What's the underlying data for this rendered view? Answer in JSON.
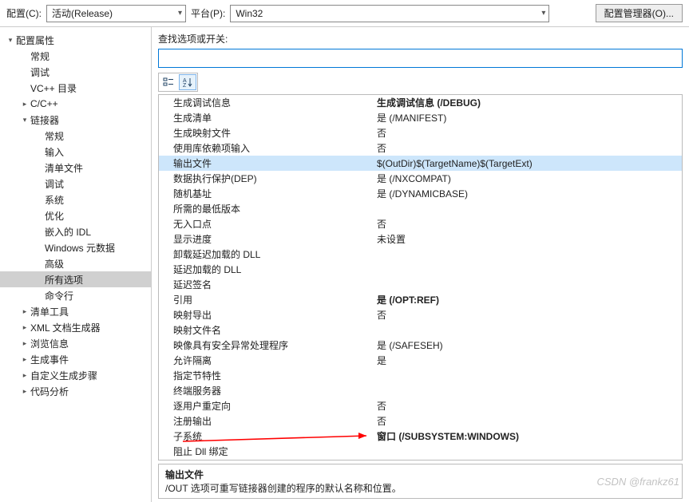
{
  "topbar": {
    "config_label": "配置(C):",
    "config_value": "活动(Release)",
    "platform_label": "平台(P):",
    "platform_value": "Win32",
    "config_manager_btn": "配置管理器(O)..."
  },
  "sidebar": {
    "items": [
      {
        "label": "配置属性",
        "depth": 0,
        "arrow": "▾"
      },
      {
        "label": "常规",
        "depth": 1,
        "arrow": ""
      },
      {
        "label": "调试",
        "depth": 1,
        "arrow": ""
      },
      {
        "label": "VC++ 目录",
        "depth": 1,
        "arrow": ""
      },
      {
        "label": "C/C++",
        "depth": 1,
        "arrow": "▸"
      },
      {
        "label": "链接器",
        "depth": 1,
        "arrow": "▾"
      },
      {
        "label": "常规",
        "depth": 2,
        "arrow": ""
      },
      {
        "label": "输入",
        "depth": 2,
        "arrow": ""
      },
      {
        "label": "清单文件",
        "depth": 2,
        "arrow": ""
      },
      {
        "label": "调试",
        "depth": 2,
        "arrow": ""
      },
      {
        "label": "系统",
        "depth": 2,
        "arrow": ""
      },
      {
        "label": "优化",
        "depth": 2,
        "arrow": ""
      },
      {
        "label": "嵌入的 IDL",
        "depth": 2,
        "arrow": ""
      },
      {
        "label": "Windows 元数据",
        "depth": 2,
        "arrow": ""
      },
      {
        "label": "高级",
        "depth": 2,
        "arrow": ""
      },
      {
        "label": "所有选项",
        "depth": 2,
        "arrow": "",
        "selected": true
      },
      {
        "label": "命令行",
        "depth": 2,
        "arrow": ""
      },
      {
        "label": "清单工具",
        "depth": 1,
        "arrow": "▸"
      },
      {
        "label": "XML 文档生成器",
        "depth": 1,
        "arrow": "▸"
      },
      {
        "label": "浏览信息",
        "depth": 1,
        "arrow": "▸"
      },
      {
        "label": "生成事件",
        "depth": 1,
        "arrow": "▸"
      },
      {
        "label": "自定义生成步骤",
        "depth": 1,
        "arrow": "▸"
      },
      {
        "label": "代码分析",
        "depth": 1,
        "arrow": "▸"
      }
    ]
  },
  "search": {
    "label": "查找选项或开关:",
    "value": ""
  },
  "grid": {
    "rows": [
      {
        "name": "生成调试信息",
        "value": "生成调试信息 (/DEBUG)",
        "bold": true
      },
      {
        "name": "生成清单",
        "value": "是 (/MANIFEST)"
      },
      {
        "name": "生成映射文件",
        "value": "否"
      },
      {
        "name": "使用库依赖项输入",
        "value": "否"
      },
      {
        "name": "输出文件",
        "value": "$(OutDir)$(TargetName)$(TargetExt)",
        "selected": true
      },
      {
        "name": "数据执行保护(DEP)",
        "value": "是 (/NXCOMPAT)"
      },
      {
        "name": "随机基址",
        "value": "是 (/DYNAMICBASE)"
      },
      {
        "name": "所需的最低版本",
        "value": ""
      },
      {
        "name": "无入口点",
        "value": "否"
      },
      {
        "name": "显示进度",
        "value": "未设置"
      },
      {
        "name": "卸载延迟加载的 DLL",
        "value": ""
      },
      {
        "name": "延迟加载的 DLL",
        "value": ""
      },
      {
        "name": "延迟签名",
        "value": ""
      },
      {
        "name": "引用",
        "value": "是 (/OPT:REF)",
        "bold": true
      },
      {
        "name": "映射导出",
        "value": "否"
      },
      {
        "name": "映射文件名",
        "value": ""
      },
      {
        "name": "映像具有安全异常处理程序",
        "value": "是 (/SAFESEH)"
      },
      {
        "name": "允许隔离",
        "value": "是"
      },
      {
        "name": "指定节特性",
        "value": ""
      },
      {
        "name": "终端服务器",
        "value": ""
      },
      {
        "name": "逐用户重定向",
        "value": "否"
      },
      {
        "name": "注册输出",
        "value": "否"
      },
      {
        "name": "子系统",
        "value": "窗口 (/SUBSYSTEM:WINDOWS)",
        "bold": true
      },
      {
        "name": "阻止 Dll 绑定",
        "value": ""
      }
    ]
  },
  "description": {
    "title": "输出文件",
    "body": "/OUT 选项可重写链接器创建的程序的默认名称和位置。"
  },
  "watermark": "CSDN @frankz61"
}
